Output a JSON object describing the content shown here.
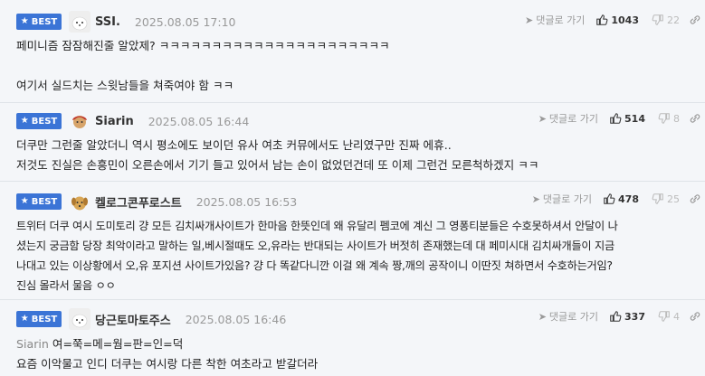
{
  "badge_label": "BEST",
  "reply_label": "댓글로 가기",
  "comments": [
    {
      "nick": "SSI.",
      "date": "2025.08.05 17:10",
      "up": "1043",
      "down": "22",
      "lines": [
        "페미니즘 잠잠해진줄 알았제? ㅋㅋㅋㅋㅋㅋㅋㅋㅋㅋㅋㅋㅋㅋㅋㅋㅋㅋㅋㅋㅋㅋ",
        "",
        "여기서 실드치는 스윗남들을 쳐죽여야 함 ㅋㅋ"
      ]
    },
    {
      "nick": "Siarin",
      "date": "2025.08.05 16:44",
      "up": "514",
      "down": "8",
      "lines": [
        "더쿠만 그런줄 알았더니 역시 평소에도 보이던 유사 여초 커뮤에서도 난리였구만 진짜 에휴..",
        "저것도 진실은 손흥민이 오른손에서 기기 들고 있어서 남는 손이 없었던건데 또 이제 그런건 모른척하겠지 ㅋㅋ"
      ]
    },
    {
      "nick": "켈로그콘푸로스트",
      "date": "2025.08.05 16:53",
      "up": "478",
      "down": "25",
      "lines": [
        "트위터 더쿠 여시 도미토리 걍 모든 김치싸개사이트가 한마음 한뜻인데 왜 유달리 펨코에 계신 그 영퐁티분들은 수호못하셔서 안달이 나",
        "셨는지 궁금함 당장 최악이라고 말하는 일,베시절때도 오,유라는 반대되는 사이트가 버젓히 존재했는데 대 페미시대 김치싸개들이 지금",
        "나대고 있는 이상황에서 오,유 포지션 사이트가있음? 걍 다 똑같다니깐 이걸 왜 계속 짱,깨의 공작이니 이딴짓 쳐하면서 수호하는거임?",
        "진심 몰라서 물음 ㅇㅇ"
      ]
    },
    {
      "nick": "당근토마토주스",
      "date": "2025.08.05 16:46",
      "up": "337",
      "down": "4",
      "mention": "Siarin",
      "lines": [
        "여=쭉=메=웜=판=인=덕",
        "요즘 이악물고 인디 더쿠는 여시랑 다른 착한 여초라고 받갈더라"
      ]
    }
  ]
}
